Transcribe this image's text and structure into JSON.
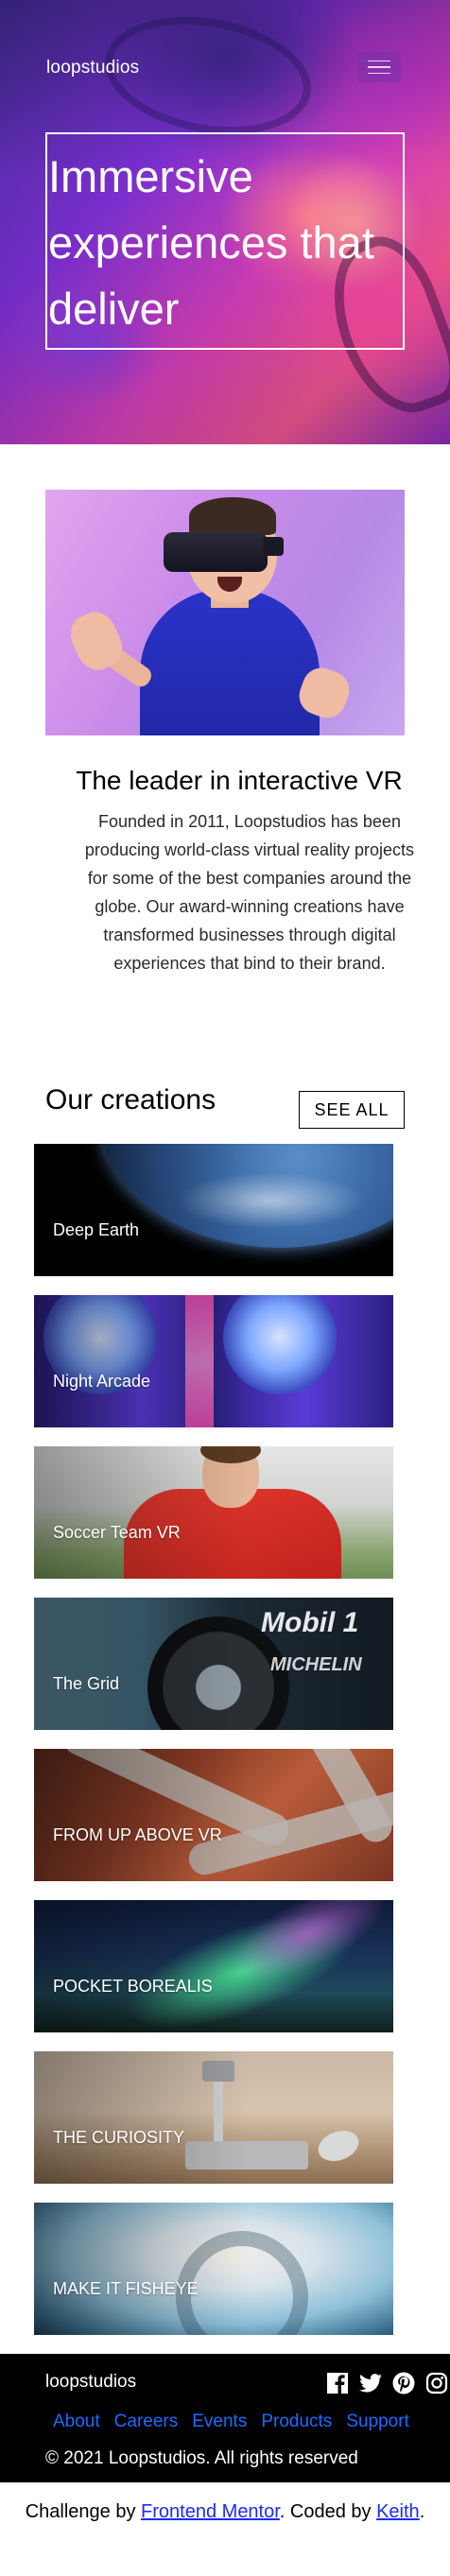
{
  "header": {
    "logo": "loopstudios",
    "menu_icon": "hamburger-menu-icon"
  },
  "hero": {
    "title": "Immersive experiences that deliver"
  },
  "intro": {
    "image_alt": "man-wearing-vr-headset",
    "title": "The leader in interactive VR",
    "text": "Founded in 2011, Loopstudios has been producing world-class virtual reality projects for some of the best companies around the globe. Our award-winning creations have transformed businesses through digital experiences that bind to their brand."
  },
  "creations": {
    "title": "Our creations",
    "see_all_label": "SEE ALL",
    "items": [
      {
        "label": "Deep Earth"
      },
      {
        "label": "Night Arcade"
      },
      {
        "label": "Soccer Team VR"
      },
      {
        "label": "The Grid"
      },
      {
        "label": "FROM UP ABOVE VR"
      },
      {
        "label": "POCKET BOREALIS"
      },
      {
        "label": "THE CURIOSITY"
      },
      {
        "label": "MAKE IT FISHEYE"
      }
    ]
  },
  "footer": {
    "logo": "loopstudios",
    "socials": [
      "facebook-icon",
      "twitter-icon",
      "pinterest-icon",
      "instagram-icon"
    ],
    "nav": [
      "About",
      "Careers",
      "Events",
      "Products",
      "Support"
    ],
    "copyright": "© 2021 Loopstudios. All rights reserved"
  },
  "attribution": {
    "prefix": "Challenge by ",
    "challenge_link": "Frontend Mentor",
    "middle": ". Coded by ",
    "author_link": "Keith",
    "suffix": "."
  },
  "colors": {
    "footer_bg": "#000000",
    "footer_link": "#1d6bff",
    "attribution_link": "#1a2cff"
  }
}
